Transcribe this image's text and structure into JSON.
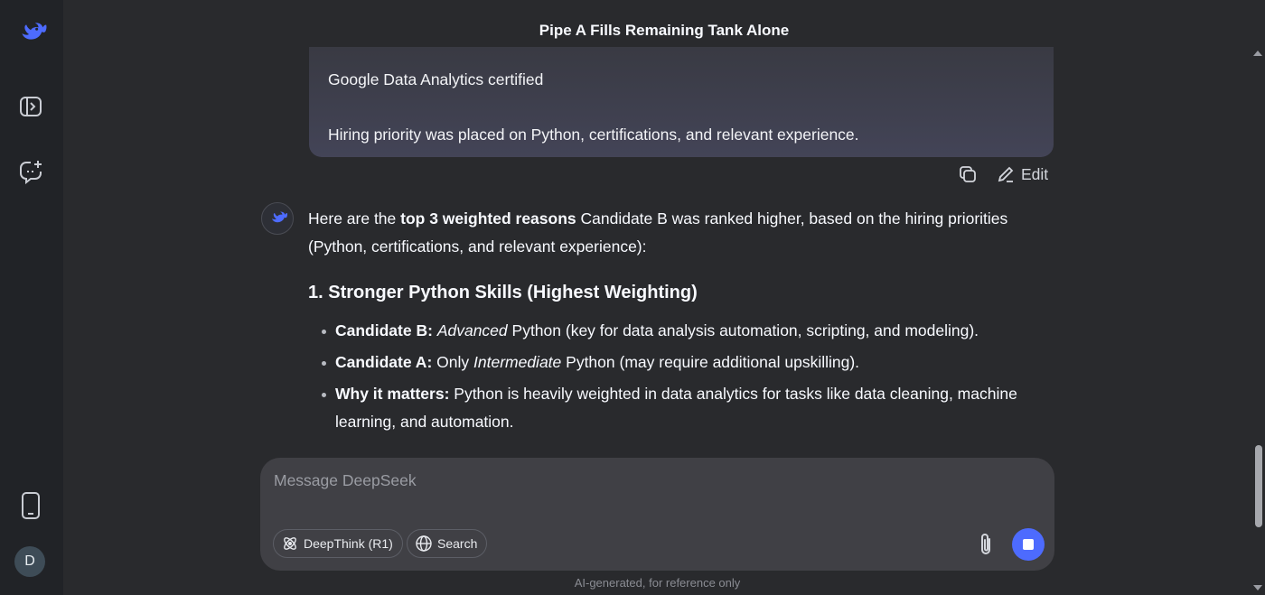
{
  "header": {
    "title": "Pipe A Fills Remaining Tank Alone"
  },
  "sidebar": {
    "items": [
      {
        "icon": "deepseek-logo-icon"
      },
      {
        "icon": "sidebar-toggle-icon"
      },
      {
        "icon": "new-chat-icon"
      },
      {
        "icon": "mobile-app-icon"
      }
    ],
    "avatar_letter": "D"
  },
  "user_message": {
    "line1": "Google Data Analytics certified",
    "line2": "Hiring priority was placed on Python, certifications, and relevant experience.",
    "actions": {
      "copy_icon": "copy-icon",
      "edit_label": "Edit"
    }
  },
  "answer": {
    "intro_pre": "Here are the ",
    "intro_bold": "top 3 weighted reasons",
    "intro_post": " Candidate B was ranked higher, based on the hiring priorities (Python, certifications, and relevant experience):",
    "section_heading": "1. Stronger Python Skills (Highest Weighting)",
    "bullets": [
      {
        "label": "Candidate B:",
        "italic": "Advanced",
        "text": " Python (key for data analysis automation, scripting, and modeling)."
      },
      {
        "label": "Candidate A:",
        "pre": " Only ",
        "italic": "Intermediate",
        "text": " Python (may require additional upskilling)."
      },
      {
        "label": "Why it matters:",
        "text": " Python is heavily weighted in data analytics for tasks like data cleaning, machine learning, and automation."
      }
    ]
  },
  "composer": {
    "placeholder": "Message DeepSeek",
    "deepthink_label": "DeepThink (R1)",
    "search_label": "Search",
    "attach_icon": "paperclip-icon",
    "stop_icon": "stop-icon"
  },
  "footer": {
    "note": "AI-generated, for reference only"
  },
  "colors": {
    "accent": "#4d6bfe",
    "background": "#292a2d",
    "sidebar": "#212327"
  }
}
